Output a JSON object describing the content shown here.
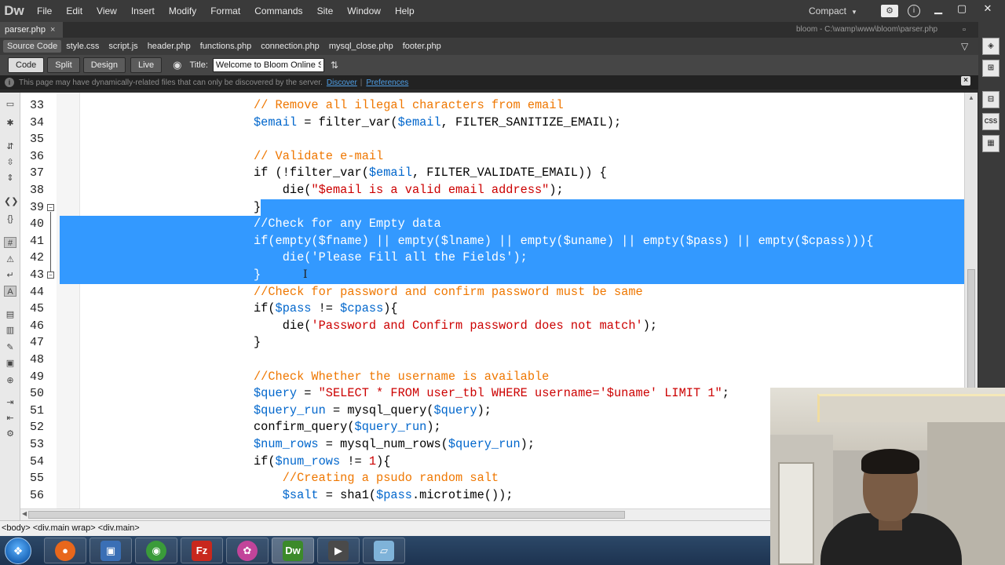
{
  "app": {
    "logo": "Dw",
    "menu": [
      "File",
      "Edit",
      "View",
      "Insert",
      "Modify",
      "Format",
      "Commands",
      "Site",
      "Window",
      "Help"
    ],
    "layout": "Compact",
    "extend_label": "⚙",
    "help_glyph": "i"
  },
  "document": {
    "tab_label": "parser.php",
    "path": "bloom - C:\\wamp\\www\\bloom\\parser.php"
  },
  "related_files": [
    "Source Code",
    "style.css",
    "script.js",
    "header.php",
    "functions.php",
    "connection.php",
    "mysql_close.php",
    "footer.php"
  ],
  "toolbar": {
    "code": "Code",
    "split": "Split",
    "design": "Design",
    "live": "Live",
    "title_label": "Title:",
    "title_value": "Welcome to Bloom Online Store"
  },
  "infobar": {
    "message": "This page may have dynamically-related files that can only be discovered by the server.",
    "discover": "Discover",
    "separator": "|",
    "preferences": "Preferences"
  },
  "code": {
    "line_numbers": [
      "33",
      "34",
      "35",
      "36",
      "37",
      "38",
      "39",
      "40",
      "41",
      "42",
      "43",
      "44",
      "45",
      "46",
      "47",
      "48",
      "49",
      "50",
      "51",
      "52",
      "53",
      "54",
      "55",
      "56"
    ],
    "selection": {
      "from_line": "39",
      "to_line": "43"
    }
  },
  "status": {
    "tag_selector": "<body> <div.main wrap> <div.main>"
  },
  "panels": [
    "◈",
    "⊞",
    "⊟",
    "CSS",
    "▦"
  ],
  "taskbar": {
    "apps": [
      "Firefox",
      "VirtualBox",
      "Chrome",
      "FileZilla",
      "Web",
      "Dw",
      "Video",
      "Notepad"
    ],
    "colors": {
      "firefox": "#e8671b",
      "virtualbox": "#3a6fb5",
      "chrome": "#3a9b3a",
      "filezilla": "#c8281d",
      "web": "#c2449a",
      "dreamweaver": "#3c8a2a",
      "video": "#4a4a4a",
      "notepad": "#7fb3d9"
    }
  },
  "colors": {
    "selection": "#3399ff",
    "comment": "#ef7700",
    "variable": "#0066cc",
    "string": "#cc0000",
    "chrome_dark": "#3a3a3a"
  }
}
